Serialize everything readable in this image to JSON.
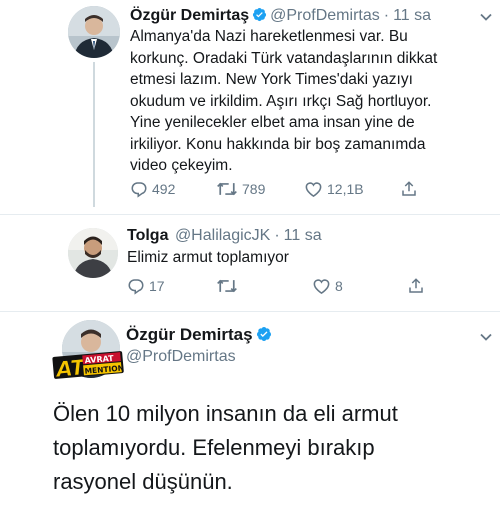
{
  "tweet1": {
    "name": "Özgür Demirtaş",
    "handle": "@ProfDemirtas",
    "separator": "·",
    "time": "11 sa",
    "text": "Almanya'da Nazi hareketlenmesi var. Bu\nkorkunç. Oradaki Türk vatandaşlarının dikkat\netmesi lazım. New York Times'daki yazıyı\nokudum ve irkildim. Aşırı ırkçı Sağ hortluyor.\nYine yenilecekler elbet ama insan yine de\nirkiliyor. Konu hakkında bir boş zamanımda\nvideo çekeyim.",
    "replies": "492",
    "retweets": "789",
    "likes": "12,1B"
  },
  "tweet2": {
    "name": "Tolga",
    "handle": "@HalilagicJK",
    "separator": "·",
    "time": "11 sa",
    "text": "Elimiz armut toplamıyor",
    "replies": "17",
    "retweets": "",
    "likes": "8"
  },
  "tweet3": {
    "name": "Özgür Demirtaş",
    "handle": "@ProfDemirtas",
    "sticker_text": "ATAVRAT MENTION",
    "text": "Ölen 10 milyon insanın da eli armut\ntoplamıyordu. Efelenmeyi bırakıp\nrasyonel düşünün."
  },
  "colors": {
    "verified": "#1da1f2",
    "text": "#14171a",
    "secondary": "#657786",
    "sticker_red": "#c8102e",
    "sticker_yellow": "#f5c400"
  },
  "icons": [
    "reply-icon",
    "retweet-icon",
    "like-icon",
    "share-icon",
    "verified-icon",
    "caret-down-icon"
  ]
}
